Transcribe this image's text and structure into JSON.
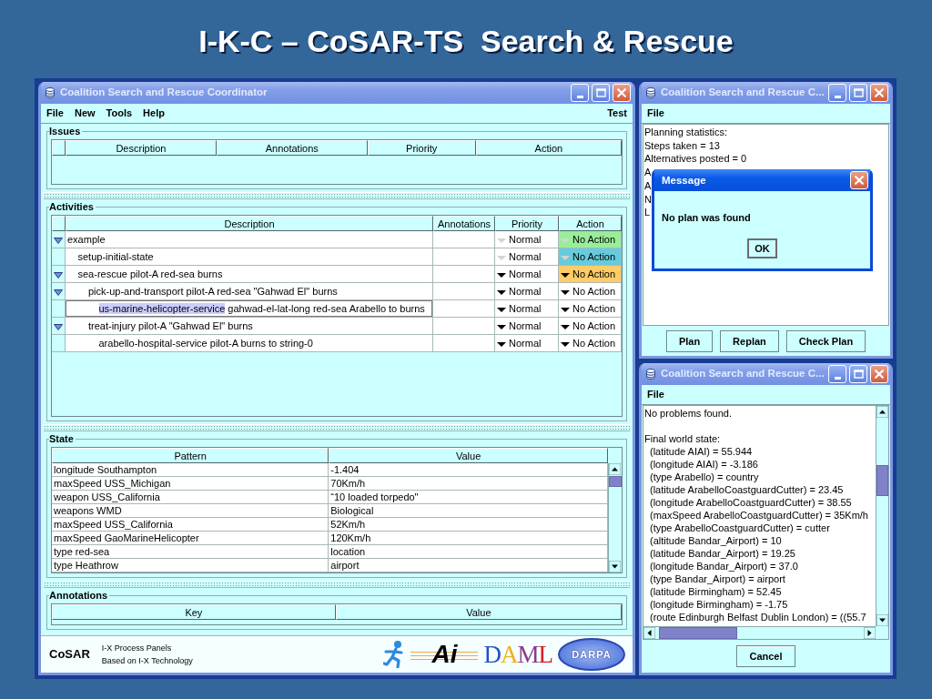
{
  "slide_title": "I-K-C – CoSAR-TS  Search & Rescue",
  "main_window": {
    "title": "Coalition Search and Rescue Coordinator",
    "menu": [
      "File",
      "New",
      "Tools",
      "Help"
    ],
    "menu_right": "Test",
    "issues": {
      "title": "Issues",
      "columns": [
        "Description",
        "Annotations",
        "Priority",
        "Action"
      ]
    },
    "activities": {
      "title": "Activities",
      "columns": [
        "Description",
        "Annotations",
        "Priority",
        "Action"
      ],
      "rows": [
        {
          "verb": "example",
          "priority": "Normal",
          "action": "No Action",
          "disabled": true,
          "color": "#99ee99",
          "selected": false,
          "expanded": true,
          "children": [
            {
              "verb": "setup-initial-state",
              "priority": "Normal",
              "action": "No Action",
              "disabled": true,
              "color": "#66ccdd",
              "selected": false
            },
            {
              "verb": "sea-rescue",
              "parameters": "pilot-A red-sea burns",
              "priority": "Normal",
              "action": "No Action",
              "disabled": false,
              "color": "#ffcc66",
              "selected": false,
              "expanded": true,
              "children": [
                {
                  "verb": "pick-up-and-transport",
                  "parameters": "pilot-A red-sea \"Gahwad El\" burns",
                  "priority": "Normal",
                  "action": "No Action",
                  "disabled": false,
                  "color": "#ffffff",
                  "selected": false,
                  "expanded": true,
                  "children": [
                    {
                      "verb": "us-marine-helicopter-service",
                      "parameters": "gahwad-el-lat-long red-sea Arabello to burns",
                      "priority": "Normal",
                      "action": "No Action",
                      "disabled": false,
                      "color": "#ffffff",
                      "selected": true
                    }
                  ]
                },
                {
                  "verb": "treat-injury",
                  "parameters": "pilot-A \"Gahwad El\" burns",
                  "priority": "Normal",
                  "action": "No Action",
                  "disabled": false,
                  "color": "#ffffff",
                  "selected": false,
                  "expanded": true,
                  "children": [
                    {
                      "verb": "arabello-hospital-service",
                      "parameters": "pilot-A burns to string-0",
                      "priority": "Normal",
                      "action": "No Action",
                      "disabled": false,
                      "color": "#ffffff",
                      "selected": false
                    }
                  ]
                }
              ]
            }
          ]
        }
      ]
    },
    "state": {
      "title": "State",
      "columns": [
        "Pattern",
        "Value"
      ],
      "rows": [
        {
          "pattern": "longitude Southampton",
          "value": "-1.404"
        },
        {
          "pattern": "maxSpeed USS_Michigan",
          "value": "70Km/h"
        },
        {
          "pattern": "weapon USS_California",
          "value": "“10 loaded torpedo\""
        },
        {
          "pattern": "weapons WMD",
          "value": "Biological"
        },
        {
          "pattern": "maxSpeed USS_California",
          "value": "52Km/h"
        },
        {
          "pattern": "maxSpeed GaoMarineHelicopter",
          "value": "120Km/h"
        },
        {
          "pattern": "type red-sea",
          "value": "location"
        },
        {
          "pattern": "type Heathrow",
          "value": "airport"
        }
      ]
    },
    "annotations": {
      "title": "Annotations",
      "columns": [
        "Key",
        "Value"
      ]
    },
    "footer": {
      "app_name": "CoSAR",
      "lines": [
        "I-X Process Panels",
        "Based on I-X Technology"
      ],
      "logos": [
        {
          "kind": "figure"
        },
        {
          "kind": "ai",
          "text": "Ai"
        },
        {
          "kind": "daml",
          "text": "DAML"
        },
        {
          "kind": "darpa",
          "text": "DARPA"
        }
      ]
    }
  },
  "planner_window": {
    "title": "Coalition Search and Rescue C...",
    "menu": [
      "File"
    ],
    "lines": [
      "Planning statistics:",
      "Steps taken = 13",
      "Alternatives posted = 0",
      "A",
      "A",
      "N",
      "L"
    ],
    "buttons": [
      "Plan",
      "Replan",
      "Check Plan"
    ],
    "dialog": {
      "title": "Message",
      "message": "No plan was found",
      "button": "OK"
    }
  },
  "checker_window": {
    "title": "Coalition Search and Rescue C...",
    "menu": [
      "File"
    ],
    "summary": "No problems found.",
    "heading": "Final world state:",
    "lines": [
      "(latitude AIAI) = 55.944",
      "(longitude AIAI) = -3.186",
      "(type Arabello) = country",
      "(latitude ArabelloCoastguardCutter) = 23.45",
      "(longitude ArabelloCoastguardCutter) = 38.55",
      "(maxSpeed ArabelloCoastguardCutter) = 35Km/h",
      "(type ArabelloCoastguardCutter) = cutter",
      "(altitude Bandar_Airport) = 10",
      "(latitude Bandar_Airport) = 19.25",
      "(longitude Bandar_Airport) = 37.0",
      "(type Bandar_Airport) = airport",
      "(latitude Birmingham) = 52.45",
      "(longitude Birmingham) = -1.75",
      "(route Edinburgh Belfast Dublin London) = ((55.7"
    ],
    "button": "Cancel"
  }
}
